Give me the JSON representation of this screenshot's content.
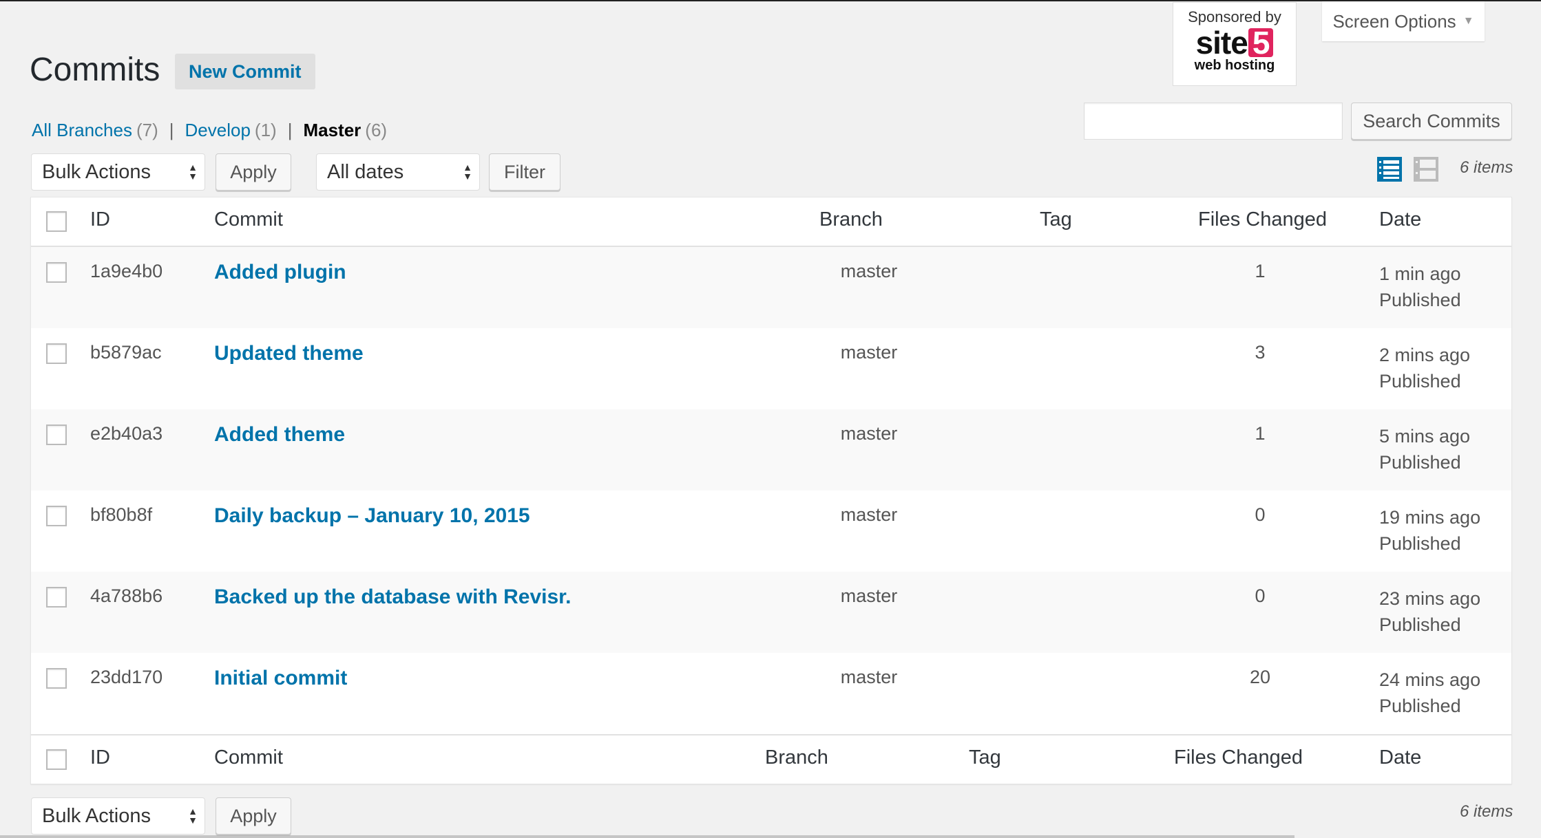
{
  "header": {
    "title": "Commits",
    "new_button": "New Commit",
    "screen_options": "Screen Options"
  },
  "sponsor": {
    "label": "Sponsored by",
    "brand_word": "site",
    "brand_number": "5",
    "tagline": "web hosting",
    "brand_color": "#e0245e"
  },
  "filters": {
    "views": [
      {
        "label": "All Branches",
        "count": "(7)",
        "current": false
      },
      {
        "label": "Develop",
        "count": "(1)",
        "current": false
      },
      {
        "label": "Master",
        "count": "(6)",
        "current": true
      }
    ],
    "separator": "|"
  },
  "search": {
    "value": "",
    "placeholder": "",
    "button": "Search Commits"
  },
  "tablenav_top": {
    "bulk_actions": "Bulk Actions",
    "apply": "Apply",
    "dates": "All dates",
    "filter": "Filter",
    "items": "6 items",
    "view_modes": [
      {
        "icon": "list-view-icon",
        "active": true
      },
      {
        "icon": "excerpt-view-icon",
        "active": false
      }
    ]
  },
  "table": {
    "columns": [
      "ID",
      "Commit",
      "Branch",
      "Tag",
      "Files Changed",
      "Date"
    ],
    "rows": [
      {
        "id": "1a9e4b0",
        "commit": "Added plugin",
        "branch": "master",
        "tag": "",
        "files": "1",
        "date": "1 min ago",
        "status": "Published"
      },
      {
        "id": "b5879ac",
        "commit": "Updated theme",
        "branch": "master",
        "tag": "",
        "files": "3",
        "date": "2 mins ago",
        "status": "Published"
      },
      {
        "id": "e2b40a3",
        "commit": "Added theme",
        "branch": "master",
        "tag": "",
        "files": "1",
        "date": "5 mins ago",
        "status": "Published"
      },
      {
        "id": "bf80b8f",
        "commit": "Daily backup – January 10, 2015",
        "branch": "master",
        "tag": "",
        "files": "0",
        "date": "19 mins ago",
        "status": "Published"
      },
      {
        "id": "4a788b6",
        "commit": "Backed up the database with Revisr.",
        "branch": "master",
        "tag": "",
        "files": "0",
        "date": "23 mins ago",
        "status": "Published"
      },
      {
        "id": "23dd170",
        "commit": "Initial commit",
        "branch": "master",
        "tag": "",
        "files": "20",
        "date": "24 mins ago",
        "status": "Published"
      }
    ]
  },
  "tablenav_bottom": {
    "bulk_actions": "Bulk Actions",
    "apply": "Apply",
    "items": "6 items"
  },
  "colors": {
    "link": "#0073aa",
    "background": "#f1f1f1",
    "active_view_icon": "#0073aa",
    "inactive_view_icon": "#bbbbbb"
  }
}
